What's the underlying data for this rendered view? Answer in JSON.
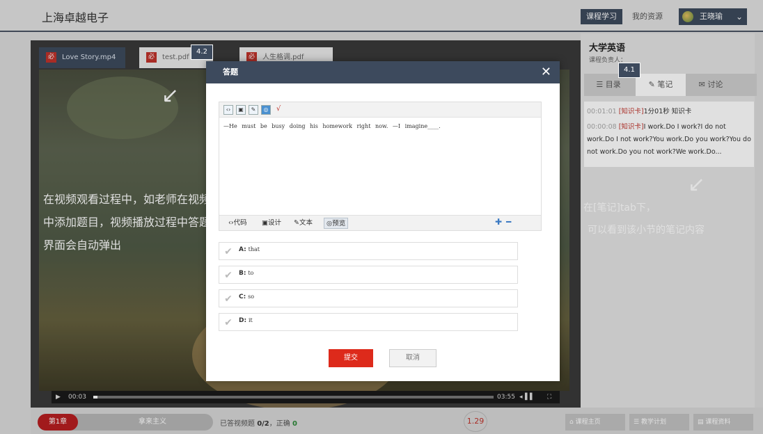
{
  "header": {
    "brand": "上海卓越电子",
    "nav_course": "课程学习",
    "nav_resources": "我的资源",
    "user_name": "王晓瑜"
  },
  "file_tabs": [
    {
      "label": "Love Story.mp4",
      "icon": "必"
    },
    {
      "label": "test.pdf",
      "icon": "必"
    },
    {
      "label": "人生格调.pdf",
      "icon": "必"
    }
  ],
  "video": {
    "overlay_text": "在视频观看过程中，如老师在视频中添加题目，视频播放过程中答题界面会自动弹出",
    "current_time": "00:03",
    "total_time": "03:55",
    "progress": 0.01
  },
  "callouts": {
    "modal": "4.2",
    "notes_tab": "4.1"
  },
  "modal": {
    "title": "答题",
    "question": "—He  must  be  busy  doing  his  homework  right  now.    —I  imagine____.",
    "editor_modes": [
      "代码",
      "设计",
      "文本",
      "预览"
    ],
    "options": [
      {
        "key": "A:",
        "text": "that"
      },
      {
        "key": "B:",
        "text": "to"
      },
      {
        "key": "C:",
        "text": "so"
      },
      {
        "key": "D:",
        "text": "it"
      }
    ],
    "submit": "提交",
    "cancel": "取消"
  },
  "right_panel": {
    "course_title": "大学英语",
    "course_owner": "课程负责人：",
    "tabs": [
      "目录",
      "笔记",
      "讨论"
    ],
    "notes": [
      {
        "time": "00:01:01",
        "tag": "[知识卡]",
        "text": "1分01秒 知识卡"
      },
      {
        "time": "00:00:08",
        "tag": "[知识卡]",
        "text": "I work.Do I work?I do not work.Do I not work?You work.Do you work?You do not work.Do you not work?We work.Do..."
      }
    ],
    "hint_line1": "在[笔记]tab下，",
    "hint_line2": "可以看到该小节的笔记内容"
  },
  "bottom": {
    "chapter_num": "第1章",
    "chapter_name": "拿来主义",
    "stats_prefix": "已答视频题",
    "answered": "0/2",
    "stats_mid": "，正确",
    "correct": "0",
    "speed": "1.29",
    "buttons": [
      "课程主页",
      "教学计划",
      "课程资料"
    ]
  },
  "colors": {
    "accent": "#3d4a5d",
    "submit": "#dd2a1b",
    "chapter": "#b81e20",
    "note_tag": "#c0332b"
  }
}
